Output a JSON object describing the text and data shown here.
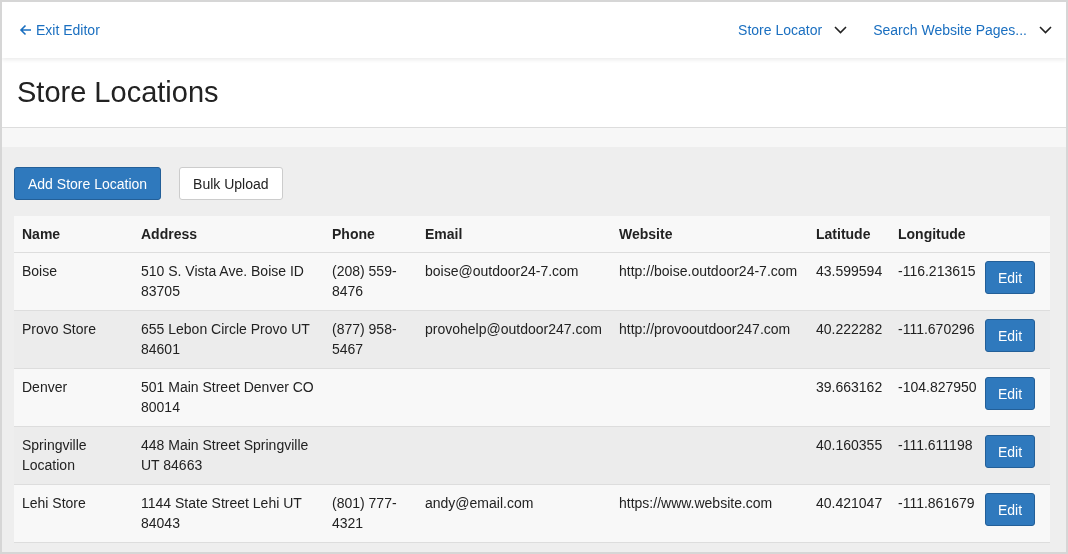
{
  "top_bar": {
    "back_link": "Exit Editor",
    "dropdowns": [
      "Store Locator",
      "Search Website Pages..."
    ]
  },
  "page_title": "Store Locations",
  "actions": [
    {
      "label": "Add Store Location",
      "kind": "primary"
    },
    {
      "label": "Bulk Upload",
      "kind": "secondary"
    }
  ],
  "table": {
    "columns": [
      "Name",
      "Address",
      "Phone",
      "Email",
      "Website",
      "Latitude",
      "Longitude"
    ],
    "rows": [
      {
        "name": "Boise",
        "address": "510 S. Vista Ave. Boise ID 83705",
        "phone": "(208) 559-8476",
        "email": "boise@outdoor24-7.com",
        "website": "http://boise.outdoor24-7.com",
        "latitude": "43.599594",
        "longitude": "-116.213615",
        "action": "Edit"
      },
      {
        "name": "Provo Store",
        "address": "655 Lebon Circle Provo UT 84601",
        "phone": "(877) 958-5467",
        "email": "provohelp@outdoor247.com",
        "website": "http://provooutdoor247.com",
        "latitude": "40.222282",
        "longitude": "-111.670296",
        "action": "Edit"
      },
      {
        "name": "Denver",
        "address": "501 Main Street Denver CO 80014",
        "latitude": "39.663162",
        "longitude": "-104.827950",
        "action": "Edit"
      },
      {
        "name": "Springville Location",
        "address": "448 Main Street Springville UT 84663",
        "latitude": "40.160355",
        "longitude": "-111.611198",
        "action": "Edit"
      },
      {
        "name": "Lehi Store",
        "address": "1144 State Street Lehi UT 84043",
        "phone": "(801) 777-4321",
        "email": "andy@email.com",
        "website": "https://www.website.com",
        "latitude": "40.421047",
        "longitude": "-111.861679",
        "action": "Edit"
      }
    ]
  }
}
